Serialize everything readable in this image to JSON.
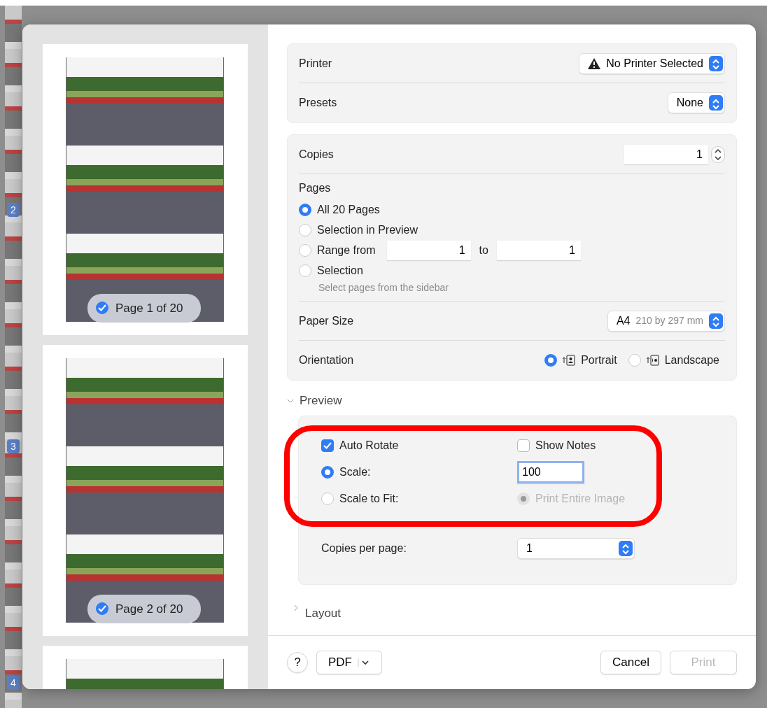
{
  "background": {
    "sidebar_badges": [
      "2",
      "3",
      "4"
    ]
  },
  "thumbnails": [
    {
      "kind": "page",
      "label": "Page 1 of 20",
      "checked": true
    },
    {
      "kind": "page",
      "label": "Page 2 of 20",
      "checked": true
    },
    {
      "kind": "cut"
    }
  ],
  "printer": {
    "label": "Printer",
    "value": "No Printer Selected"
  },
  "presets": {
    "label": "Presets",
    "value": "None"
  },
  "copies": {
    "label": "Copies",
    "value": "1"
  },
  "pages": {
    "label": "Pages",
    "options": [
      {
        "kind": "plain",
        "label": "All 20 Pages",
        "selected": true
      },
      {
        "kind": "plain",
        "label": "Selection in Preview",
        "selected": false
      },
      {
        "kind": "range",
        "label": "Range from",
        "selected": false,
        "from": "1",
        "connector": "to",
        "to": "1"
      },
      {
        "kind": "hint",
        "label": "Selection",
        "selected": false,
        "hint": "Select pages from the sidebar"
      }
    ]
  },
  "paper_size": {
    "label": "Paper Size",
    "value": "A4",
    "detail": "210 by 297 mm"
  },
  "orientation": {
    "label": "Orientation",
    "options": [
      {
        "label": "Portrait",
        "selected": true
      },
      {
        "label": "Landscape",
        "selected": false
      }
    ]
  },
  "preview": {
    "title": "Preview",
    "expanded": true,
    "auto_rotate": {
      "label": "Auto Rotate",
      "checked": true
    },
    "show_notes": {
      "label": "Show Notes",
      "checked": false
    },
    "scale_options": [
      {
        "label": "Scale:",
        "selected": true
      },
      {
        "label": "Scale to Fit:",
        "selected": false
      }
    ],
    "scale_value": "100",
    "fit_option": {
      "label": "Print Entire Image",
      "selected": true,
      "disabled": true
    },
    "copies_per_page": {
      "label": "Copies per page:",
      "value": "1"
    }
  },
  "layout_section": {
    "title": "Layout",
    "expanded": false
  },
  "footer": {
    "help": "?",
    "pdf": "PDF",
    "cancel": "Cancel",
    "print": {
      "label": "Print",
      "disabled": true
    }
  }
}
